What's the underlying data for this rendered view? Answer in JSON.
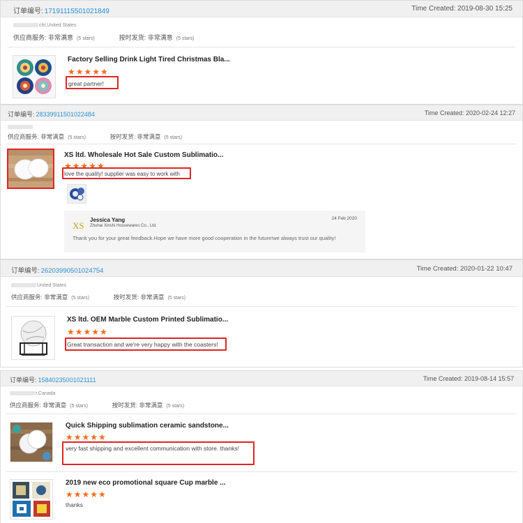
{
  "labels": {
    "order_no": "订单编号:",
    "time_created": "Time Created:",
    "supplier_service": "供应商服务:",
    "on_time_delivery": "按时发货:"
  },
  "orders": [
    {
      "order_no": "17191115501021849",
      "time_created": "2019-08-30 15:25",
      "buyer_location": "cht,United States",
      "supplier_rating": "非常满意",
      "supplier_stars": "(5 stars)",
      "delivery_rating": "非常满意",
      "delivery_stars": "(5 stars)",
      "products": [
        {
          "title": "Factory Selling Drink Light Tired Christmas Bla...",
          "stars": "★★★★★",
          "review": "great partner!",
          "image_icon": "mandala-coasters-icon"
        }
      ]
    },
    {
      "order_no": "28339911501022484",
      "time_created": "2020-02-24 12:27",
      "buyer_location": "",
      "supplier_rating": "非常满意",
      "supplier_stars": "(5 stars)",
      "delivery_rating": "非常满意",
      "delivery_stars": "(5 stars)",
      "products": [
        {
          "title": "XS ltd. Wholesale Hot Sale Custom Sublimatio...",
          "stars": "★★★★★",
          "review": "love the quality! supplier was easy to work with",
          "image_icon": "white-coasters-icon",
          "review_photo_icon": "blue-porcelain-icon",
          "reply": {
            "logo": "XS",
            "name": "Jessica Yang",
            "company": "Zhuhai Xinshi Housewares Co., Ltd.",
            "date": "24 Feb 2020",
            "text": "Thank you for your great feedback.Hope we have more good cooperation in the future!we always trust our quality!"
          }
        }
      ]
    },
    {
      "order_no": "26203990501024754",
      "time_created": "2020-01-22 10:47",
      "buyer_location": "United States",
      "supplier_rating": "非常满意",
      "supplier_stars": "(5 stars)",
      "delivery_rating": "非常满意",
      "delivery_stars": "(5 stars)",
      "products": [
        {
          "title": "XS ltd. OEM Marble Custom Printed Sublimatio...",
          "stars": "★★★★★",
          "review": "Great transaction and we're very happy with the coasters!",
          "image_icon": "marble-coasters-holder-icon"
        }
      ]
    },
    {
      "order_no": "15840235001021111",
      "time_created": "2019-08-14 15:57",
      "buyer_location": "r,Canada",
      "supplier_rating": "非常满意",
      "supplier_stars": "(5 stars)",
      "delivery_rating": "非常满意",
      "delivery_stars": "(5 stars)",
      "products": [
        {
          "title": "Quick Shipping sublimation ceramic sandstone...",
          "stars": "★★★★★",
          "review": "very fast shipping and excellent communication with store. thanks!",
          "image_icon": "sandstone-coasters-icon"
        },
        {
          "title": "2019 new eco promotional square Cup marble ...",
          "stars": "★★★★★",
          "review": "thanks",
          "image_icon": "tile-coasters-icon"
        }
      ]
    }
  ],
  "colors": {
    "order_link": "#2b8fd6",
    "star": "#f26b1d",
    "highlight_box": "#e02424",
    "header_bg": "#f0f0f0"
  }
}
